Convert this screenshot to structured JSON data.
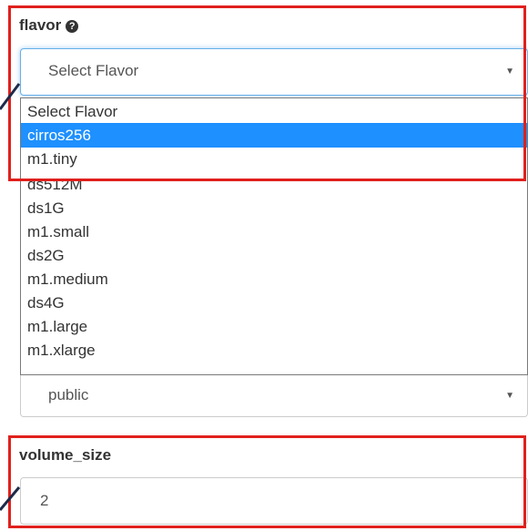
{
  "flavor": {
    "label": "flavor",
    "help_icon": "?",
    "selected": "Select Flavor",
    "options": [
      "Select Flavor",
      "cirros256",
      "m1.tiny",
      "ds512M",
      "ds1G",
      "m1.small",
      "ds2G",
      "m1.medium",
      "ds4G",
      "m1.large",
      "m1.xlarge"
    ],
    "highlighted_option": "cirros256"
  },
  "access": {
    "value": "public"
  },
  "volume_size": {
    "label": "volume_size",
    "value": "2"
  },
  "icons": {
    "flavor_help": "question-circle-icon",
    "caret": "caret-down-icon"
  },
  "colors": {
    "highlight_border": "#e0201d",
    "selected_option_bg": "#1e90ff",
    "focus_border": "#66afe9",
    "arrow": "#1c2a4a"
  }
}
